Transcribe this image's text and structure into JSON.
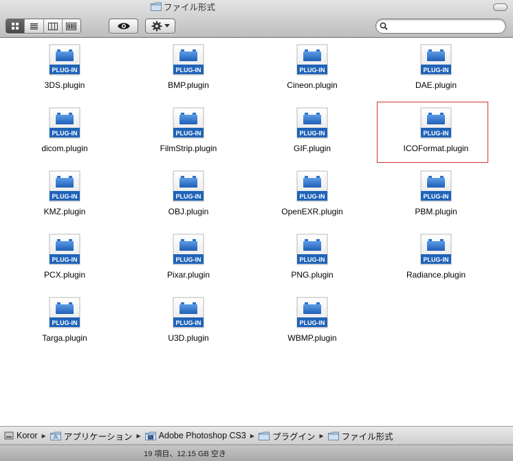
{
  "window": {
    "title": "ファイル形式"
  },
  "toolbar": {
    "view_modes": [
      "icon-view",
      "list-view",
      "column-view",
      "coverflow-view"
    ],
    "active_view": "icon-view",
    "quicklook_icon": "eye-icon",
    "action_icon": "gear-icon",
    "search_value": "",
    "search_placeholder": ""
  },
  "items": [
    {
      "label": "3DS.plugin"
    },
    {
      "label": "BMP.plugin"
    },
    {
      "label": "Cineon.plugin"
    },
    {
      "label": "DAE.plugin"
    },
    {
      "label": "dicom.plugin"
    },
    {
      "label": "FilmStrip.plugin"
    },
    {
      "label": "GIF.plugin"
    },
    {
      "label": "ICOFormat.plugin",
      "selected": true
    },
    {
      "label": "KMZ.plugin"
    },
    {
      "label": "OBJ.plugin"
    },
    {
      "label": "OpenEXR.plugin"
    },
    {
      "label": "PBM.plugin"
    },
    {
      "label": "PCX.plugin"
    },
    {
      "label": "Pixar.plugin"
    },
    {
      "label": "PNG.plugin"
    },
    {
      "label": "Radiance.plugin"
    },
    {
      "label": "Targa.plugin"
    },
    {
      "label": "U3D.plugin"
    },
    {
      "label": "WBMP.plugin"
    }
  ],
  "icon_badge_text": "PLUG-IN",
  "pathbar": [
    {
      "label": "Koror",
      "icon": "hard-drive-icon"
    },
    {
      "label": "アプリケーション",
      "icon": "applications-folder-icon"
    },
    {
      "label": "Adobe Photoshop CS3",
      "icon": "photoshop-folder-icon"
    },
    {
      "label": "プラグイン",
      "icon": "folder-icon"
    },
    {
      "label": "ファイル形式",
      "icon": "folder-icon"
    }
  ],
  "status": {
    "text": "19 項目、12.15 GB 空き"
  },
  "colors": {
    "plugin_blue": "#1f63b8",
    "selection_border": "#d03030"
  }
}
